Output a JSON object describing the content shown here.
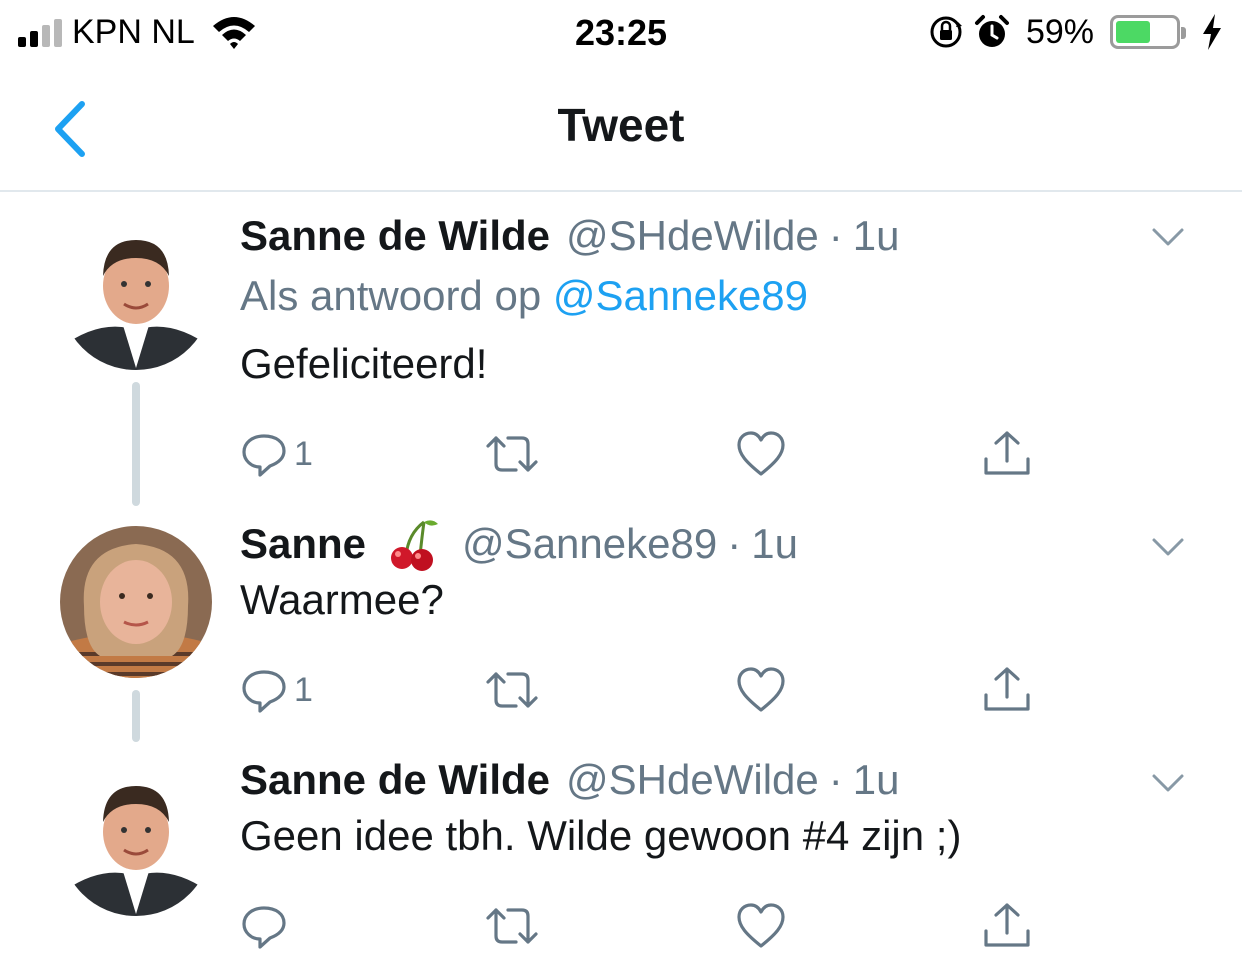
{
  "status_bar": {
    "carrier": "KPN NL",
    "time": "23:25",
    "battery_percent": "59%",
    "battery_level": 0.59,
    "icons": [
      "signal-icon",
      "wifi-icon",
      "orientation-lock-icon",
      "alarm-icon",
      "battery-icon",
      "charging-bolt-icon"
    ]
  },
  "nav": {
    "title": "Tweet",
    "back_icon": "chevron-left-icon"
  },
  "colors": {
    "accent": "#1da1f2",
    "secondary_text": "#657786",
    "thread_line": "#cfd9de",
    "battery_fill": "#4cd964"
  },
  "tweets": [
    {
      "name": "Sanne de Wilde",
      "handle": "@SHdeWilde",
      "separator": "·",
      "time": "1u",
      "reply_prefix": "Als antwoord op",
      "reply_mention": "@Sanneke89",
      "text": "Gefeliciteerd!",
      "reply_count": "1"
    },
    {
      "name": "Sanne",
      "name_emoji": "cherry-icon",
      "handle": "@Sanneke89",
      "separator": "·",
      "time": "1u",
      "text": "Waarmee?",
      "reply_count": "1"
    },
    {
      "name": "Sanne de Wilde",
      "handle": "@SHdeWilde",
      "separator": "·",
      "time": "1u",
      "text": "Geen idee tbh. Wilde gewoon #4 zijn ;)",
      "reply_count": ""
    }
  ]
}
